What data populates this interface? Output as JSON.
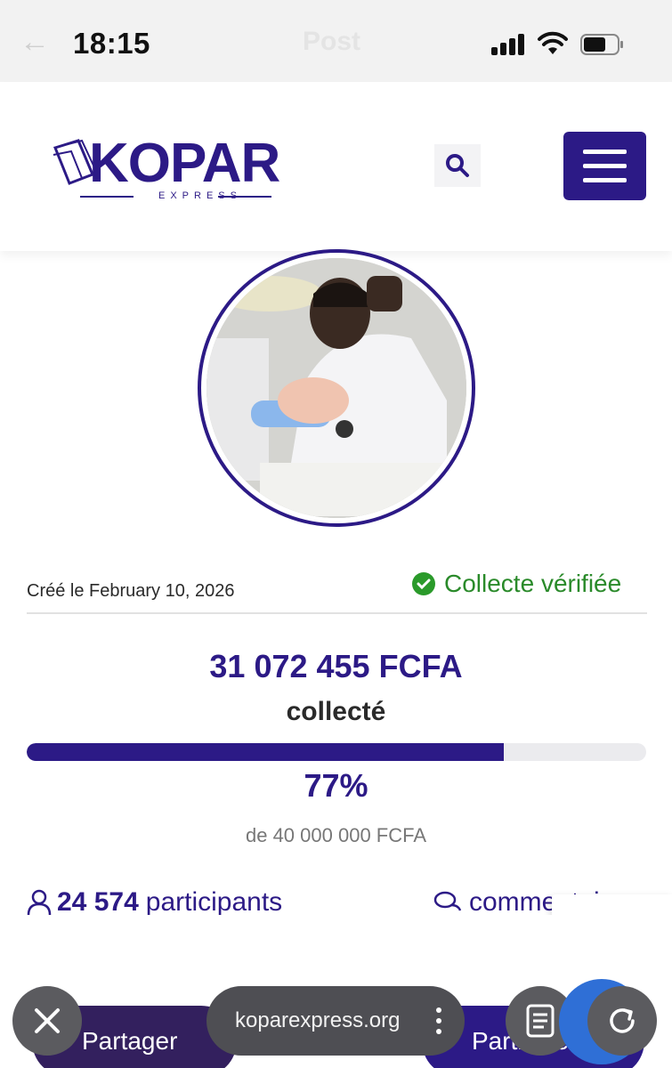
{
  "status": {
    "time": "18:15",
    "title": "Post"
  },
  "header": {
    "logo_main": "KOPAR",
    "logo_sub": "EXPRESS"
  },
  "campaign": {
    "created": "Créé le February 10, 2026",
    "verified": "Collecte vérifiée",
    "amount": "31 072 455 FCFA",
    "collected_label": "collecté",
    "progress": 0.77,
    "percent": "77%",
    "goal": "de 40 000 000 FCFA",
    "participants_count": "24 574",
    "participants_label": "participants",
    "comments_label": "commentaires"
  },
  "actions": {
    "share": "Partager",
    "participate": "Participer"
  },
  "browser": {
    "url": "koparexpress.org"
  },
  "colors": {
    "brand": "#2c1a86",
    "verified": "#2a8a2a"
  }
}
